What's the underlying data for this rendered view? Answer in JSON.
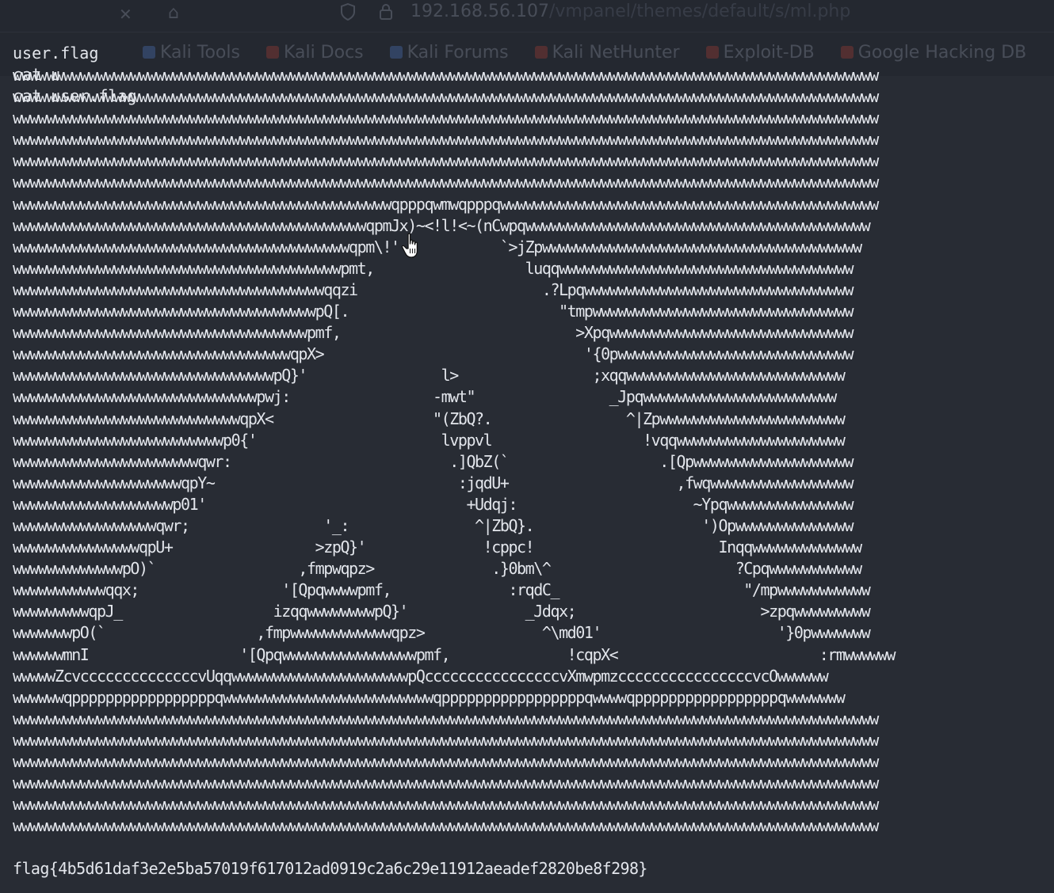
{
  "browser": {
    "close_glyph": "✕",
    "home_glyph": "⌂",
    "url_host": "192.168.56.107",
    "url_path": "/vmpanel/themes/default/s/ml.php",
    "bookmarks": [
      {
        "label": "Kali Tools",
        "icon": "kali-icon"
      },
      {
        "label": "Kali Docs",
        "icon": "kali-docs-icon"
      },
      {
        "label": "Kali Forums",
        "icon": "kali-forums-icon"
      },
      {
        "label": "Kali NetHunter",
        "icon": "nethunter-icon"
      },
      {
        "label": "Exploit-DB",
        "icon": "exploitdb-icon"
      },
      {
        "label": "Google Hacking DB",
        "icon": "ghdb-icon"
      }
    ]
  },
  "terminal": {
    "commands": [
      "user.flag",
      "cat u",
      "cat user.flag"
    ],
    "ascii_art": [
      "wwwwwwwwwwwwwwwwwwwwwwwwwwwwwwwwwwwwwwwwwwwwwwwwwwwwwwwwwwwwwwwwwwwwwwwwwwwwwwwwwwwwwwwwwwwwwwwwwwwwwww",
      "wwwwwwwwwwwwwwwwwwwwwwwwwwwwwwwwwwwwwwwwwwwwwwwwwwwwwwwwwwwwwwwwwwwwwwwwwwwwwwwwwwwwwwwwwwwwwwwwwwwwwww",
      "wwwwwwwwwwwwwwwwwwwwwwwwwwwwwwwwwwwwwwwwwwwwwwwwwwwwwwwwwwwwwwwwwwwwwwwwwwwwwwwwwwwwwwwwwwwwwwwwwwwwwww",
      "wwwwwwwwwwwwwwwwwwwwwwwwwwwwwwwwwwwwwwwwwwwwwwwwwwwwwwwwwwwwwwwwwwwwwwwwwwwwwwwwwwwwwwwwwwwwwwwwwwwwwww",
      "wwwwwwwwwwwwwwwwwwwwwwwwwwwwwwwwwwwwwwwwwwwwwwwwwwwwwwwwwwwwwwwwwwwwwwwwwwwwwwwwwwwwwwwwwwwwwwwwwwwwwww",
      "wwwwwwwwwwwwwwwwwwwwwwwwwwwwwwwwwwwwwwwwwwwwwwwwwwwwwwwwwwwwwwwwwwwwwwwwwwwwwwwwwwwwwwwwwwwwwwwwwwwwwww",
      "wwwwwwwwwwwwwwwwwwwwwwwwwwwwwwwwwwwwwwwwwwwwwqpppqwmwqpppqwwwwwwwwwwwwwwwwwwwwwwwwwwwwwwwwwwwwwwwwwwwww",
      "wwwwwwwwwwwwwwwwwwwwwwwwwwwwwwwwwwwwwwwwwwqpmJx)~<!l!<~(nCwpqwwwwwwwwwwwwwwwwwwwwwwwwwwwwwwwwwwwwwwwww",
      "wwwwwwwwwwwwwwwwwwwwwwwwwwwwwwwwwwwwwwwwqpm\\!'            `>jZpwwwwwwwwwwwwwwwwwwwwwwwwwwwwwwwwwwwwww",
      "wwwwwwwwwwwwwwwwwwwwwwwwwwwwwwwwwwwwwwwpmt,                  luqqwwwwwwwwwwwwwwwwwwwwwwwwwwwwwwwwwww",
      "wwwwwwwwwwwwwwwwwwwwwwwwwwwwwwwwwwwwwqqzi                      .?Lpqwwwwwwwwwwwwwwwwwwwwwwwwwwwwwwww",
      "wwwwwwwwwwwwwwwwwwwwwwwwwwwwwwwwwwwwpQ[.                         \"tmpwwwwwwwwwwwwwwwwwwwwwwwwwwwwwww",
      "wwwwwwwwwwwwwwwwwwwwwwwwwwwwwwwwwwwpmf,                            >Xpqwwwwwwwwwwwwwwwwwwwwwwwwwwwww",
      "wwwwwwwwwwwwwwwwwwwwwwwwwwwwwwwwwqpX>                               '{0pwwwwwwwwwwwwwwwwwwwwwwwwwwww",
      "wwwwwwwwwwwwwwwwwwwwwwwwwwwwwwwpQ}'                l>                ;xqqwwwwwwwwwwwwwwwwwwwwwwwwww",
      "wwwwwwwwwwwwwwwwwwwwwwwwwwwwwpwj:                 -mwt\"                _Jpqwwwwwwwwwwwwwwwwwwwwwww",
      "wwwwwwwwwwwwwwwwwwwwwwwwwwwqpX<                   \"(ZbQ?.                ^|Zpwwwwwwwwwwwwwwwwwwwwww",
      "wwwwwwwwwwwwwwwwwwwwwwwwwp0{'                      lvppvl                  !vqqwwwwwwwwwwwwwwwwwwww",
      "wwwwwwwwwwwwwwwwwwwwwwqwr:                          .]QbZ(`                  .[Qpwwwwwwwwwwwwwwwwwww",
      "wwwwwwwwwwwwwwwwwwwwqpY~                             :jqdU+                    ,fwqwwwwwwwwwwwwwwwww",
      "wwwwwwwwwwwwwwwwwwwp01'                               +Udqj:                     ~Ypqwwwwwwwwwwwwwww",
      "wwwwwwwwwwwwwwwwwqwr;                '_:               ^|ZbQ}.                    ')Opwwwwwwwwwwwwww",
      "wwwwwwwwwwwwwwwqpU+                 >zpQ}'              !cppc!                      Inqqwwwwwwwwwwwww",
      "wwwwwwwwwwwwwpO)`                 ,fmpwqpz>              .}0bm\\^                      ?Cpqwwwwwwwwwww",
      "wwwwwwwwwwwqqx;                 '[Qpqwwwwpmf,              :rqdC_                      \"/mpwwwwwwwwwww",
      "wwwwwwwwwqpJ_                  izqqwwwwwwwwpQ}'              _Jdqx;                      >zpqwwwwwwwww",
      "wwwwwwwpO(`                  ,fmpwwwwwwwwwwwwqpz>              ^\\md01'                     '}0pwwwwwww",
      "wwwwwwmnI                  '[Qpqwwwwwwwwwwwwwwwwpmf,              !cqpX<                        :rmwwwwww",
      "wwwwwZcvccccccccccccccvUqqwwwwwwwwwwwwwwwwwwwwwpQccccccccccccccccvXmwpmzccccccccccccccccvcOwwwwww",
      "wwwwwwqpppppppppppppppppqwwwwwwwwwwwwwwwwwwwwwwwwwqpppppppppppppppppqwwwwqpppppppppppppppppqwwwwwww",
      "wwwwwwwwwwwwwwwwwwwwwwwwwwwwwwwwwwwwwwwwwwwwwwwwwwwwwwwwwwwwwwwwwwwwwwwwwwwwwwwwwwwwwwwwwwwwwwwwwwwwwww",
      "wwwwwwwwwwwwwwwwwwwwwwwwwwwwwwwwwwwwwwwwwwwwwwwwwwwwwwwwwwwwwwwwwwwwwwwwwwwwwwwwwwwwwwwwwwwwwwwwwwwwwww",
      "wwwwwwwwwwwwwwwwwwwwwwwwwwwwwwwwwwwwwwwwwwwwwwwwwwwwwwwwwwwwwwwwwwwwwwwwwwwwwwwwwwwwwwwwwwwwwwwwwwwwwww",
      "wwwwwwwwwwwwwwwwwwwwwwwwwwwwwwwwwwwwwwwwwwwwwwwwwwwwwwwwwwwwwwwwwwwwwwwwwwwwwwwwwwwwwwwwwwwwwwwwwwwwwww",
      "wwwwwwwwwwwwwwwwwwwwwwwwwwwwwwwwwwwwwwwwwwwwwwwwwwwwwwwwwwwwwwwwwwwwwwwwwwwwwwwwwwwwwwwwwwwwwwwwwwwwwww",
      "wwwwwwwwwwwwwwwwwwwwwwwwwwwwwwwwwwwwwwwwwwwwwwwwwwwwwwwwwwwwwwwwwwwwwwwwwwwwwwwwwwwwwwwwwwwwwwwwwwwwwww"
    ],
    "flag": "flag{4b5d61daf3e2e5ba57019f617012ad0919c2a6c29e11912aeadef2820be8f298}"
  },
  "colors": {
    "background": "#282c34",
    "text": "#e3e6ec"
  }
}
